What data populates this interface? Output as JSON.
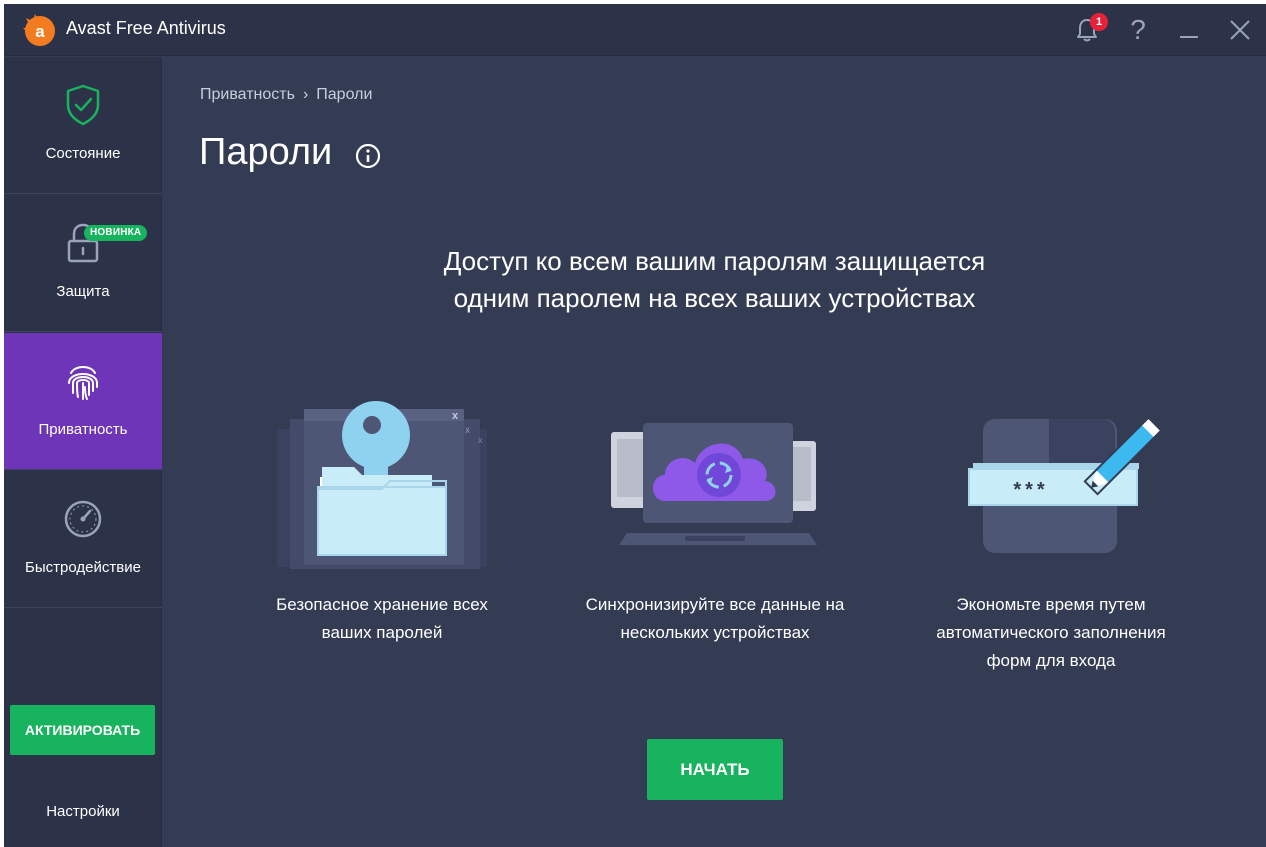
{
  "window": {
    "title": "Avast Free Antivirus"
  },
  "titlebar": {
    "notifications_count": "1",
    "help_label": "?"
  },
  "sidebar": {
    "items": [
      {
        "label": "Состояние",
        "icon": "shield-check-icon"
      },
      {
        "label": "Защита",
        "icon": "lock-icon",
        "badge": "НОВИНКА"
      },
      {
        "label": "Приватность",
        "icon": "fingerprint-icon",
        "active": true
      },
      {
        "label": "Быстродействие",
        "icon": "speedometer-icon"
      }
    ],
    "activate_label": "АКТИВИРОВАТЬ",
    "settings_label": "Настройки"
  },
  "main": {
    "breadcrumb": {
      "parent": "Приватность",
      "separator": "›",
      "current": "Пароли"
    },
    "title": "Пароли",
    "headline_line1": "Доступ ко всем вашим паролям защищается",
    "headline_line2": "одним паролем на всех ваших устройствах",
    "features": [
      {
        "line1": "Безопасное хранение всех",
        "line2": "ваших паролей",
        "line3": ""
      },
      {
        "line1": "Синхронизируйте все данные на",
        "line2": "нескольких устройствах",
        "line3": ""
      },
      {
        "line1": "Экономьте время путем",
        "line2": "автоматического заполнения",
        "line3": "форм для входа"
      }
    ],
    "password_mask": "***",
    "start_label": "НАЧАТЬ"
  },
  "colors": {
    "accent_green": "#18b35e",
    "active_purple": "#6f35b8",
    "background": "#343c54",
    "sidebar": "#2c3348",
    "brand_orange": "#f47c20"
  }
}
